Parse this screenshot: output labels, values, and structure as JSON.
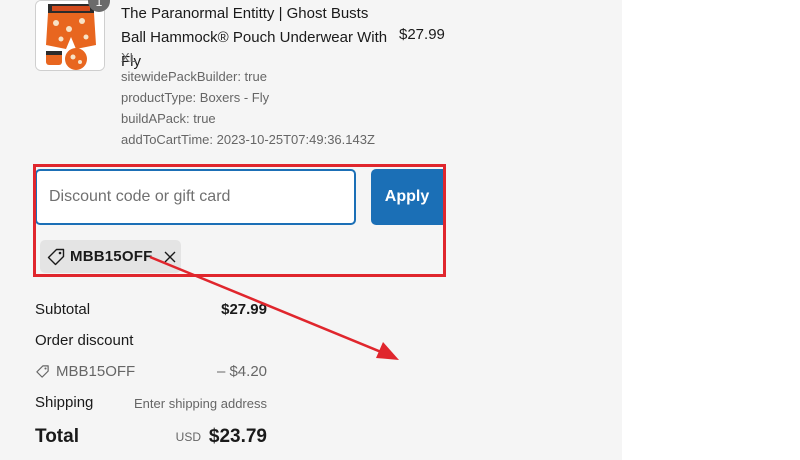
{
  "line_item": {
    "quantity": "1",
    "title": "The Paranormal Entitty | Ghost Busts Ball Hammock® Pouch Underwear With Fly",
    "price": "$27.99",
    "variant": "XL",
    "properties": [
      "sitewidePackBuilder: true",
      "productType: Boxers - Fly",
      "buildAPack: true",
      "addToCartTime: 2023-10-25T07:49:36.143Z"
    ]
  },
  "discount": {
    "placeholder": "Discount code or gift card",
    "apply_label": "Apply",
    "applied_code": "MBB15OFF"
  },
  "summary": {
    "subtotal_label": "Subtotal",
    "subtotal_value": "$27.99",
    "order_discount_label": "Order discount",
    "discount_code": "MBB15OFF",
    "discount_value": "– $4.20",
    "shipping_label": "Shipping",
    "shipping_value": "Enter shipping address",
    "total_label": "Total",
    "total_currency": "USD",
    "total_value": "$23.79"
  },
  "colors": {
    "accent": "#1b6fb6",
    "annotation": "#e0262d",
    "panel_bg": "#f5f5f5"
  }
}
